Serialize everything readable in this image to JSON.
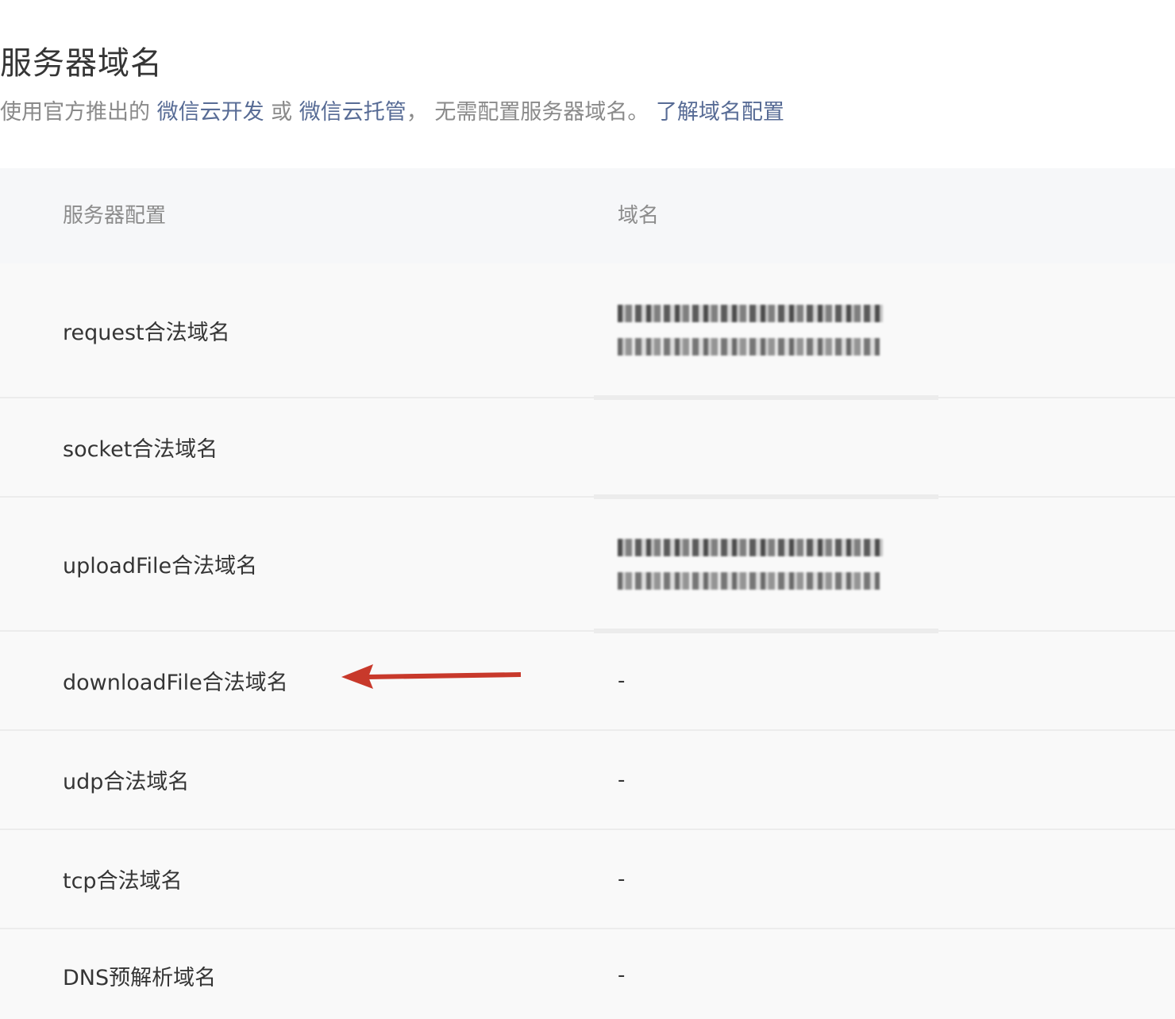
{
  "header": {
    "title": "服务器域名",
    "desc_prefix": "使用官方推出的 ",
    "link_cloud_dev": "微信云开发",
    "desc_or": " 或 ",
    "link_cloud_host": "微信云托管",
    "desc_suffix": "， 无需配置服务器域名。 ",
    "link_learn": "了解域名配置"
  },
  "table": {
    "col_config": "服务器配置",
    "col_domain": "域名",
    "rows": [
      {
        "label": "request合法域名",
        "value": ""
      },
      {
        "label": "socket合法域名",
        "value": ""
      },
      {
        "label": "uploadFile合法域名",
        "value": ""
      },
      {
        "label": "downloadFile合法域名",
        "value": "-"
      },
      {
        "label": "udp合法域名",
        "value": "-"
      },
      {
        "label": "tcp合法域名",
        "value": "-"
      },
      {
        "label": "DNS预解析域名",
        "value": "-"
      }
    ]
  },
  "colors": {
    "link": "#576b95",
    "arrow": "#c8392b"
  },
  "icons": {
    "annotation": "red-arrow-icon"
  }
}
